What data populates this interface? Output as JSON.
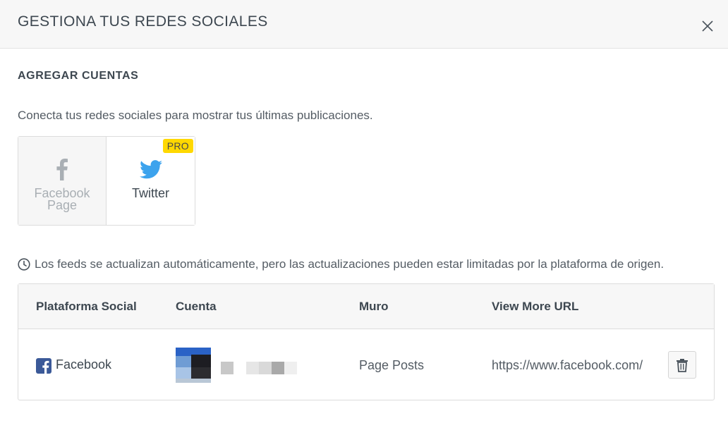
{
  "modal": {
    "title": "GESTIONA TUS REDES SOCIALES",
    "close_icon": "close-icon"
  },
  "add_accounts": {
    "title": "AGREGAR CUENTAS",
    "description": "Conecta tus redes sociales para mostrar tus últimas publicaciones.",
    "providers": [
      {
        "label_line1": "Facebook",
        "label_line2": "Page",
        "icon": "facebook-icon",
        "state": "disabled"
      },
      {
        "label": "Twitter",
        "icon": "twitter-icon",
        "badge": "PRO",
        "icon_color": "#3da3ed"
      }
    ]
  },
  "notice": {
    "icon": "clock-icon",
    "text": "Los feeds se actualizan automáticamente, pero las actualizaciones pueden estar limitadas por la plataforma de origen."
  },
  "table": {
    "headers": [
      "Plataforma Social",
      "Cuenta",
      "Muro",
      "View More URL"
    ],
    "rows": [
      {
        "platform": "Facebook",
        "platform_icon": "facebook-square-icon",
        "platform_color": "#3b5998",
        "wall": "Page Posts",
        "url": "https://www.facebook.com/",
        "action_icon": "trash-icon"
      }
    ]
  },
  "colors": {
    "header_bg": "#f7f7f7",
    "badge_bg": "#ffd800",
    "text": "#3d4750"
  }
}
